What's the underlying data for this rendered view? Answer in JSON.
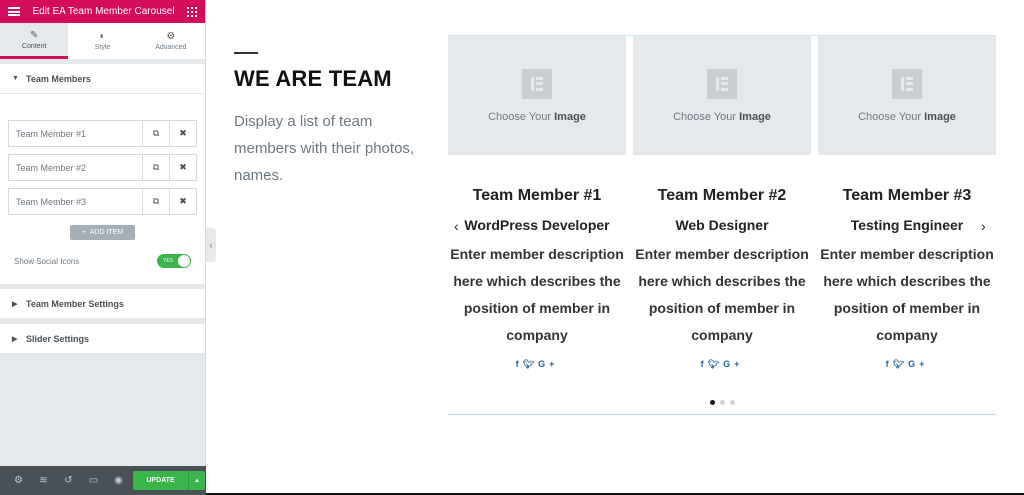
{
  "panel": {
    "header_title": "Edit EA Team Member Carousel",
    "tabs": [
      {
        "label": "Content",
        "icon": "pencil-icon"
      },
      {
        "label": "Style",
        "icon": "contrast-icon"
      },
      {
        "label": "Advanced",
        "icon": "gear-icon"
      }
    ],
    "section_team_members": "Team Members",
    "members": [
      {
        "label": "Team Member #1"
      },
      {
        "label": "Team Member #2"
      },
      {
        "label": "Team Member #3"
      }
    ],
    "add_item_label": "ADD ITEM",
    "show_social_label": "Show Social Icons",
    "show_social_toggle": "YES",
    "section_member_settings": "Team Member Settings",
    "section_slider_settings": "Slider Settings",
    "update_label": "UPDATE"
  },
  "preview": {
    "heading": "WE ARE TEAM",
    "description": "Display a list of team members with their photos, names.",
    "image_placeholder_pre": "Choose Your",
    "image_placeholder_bold": "Image",
    "cards": [
      {
        "name": "Team Member #1",
        "role": "WordPress Developer",
        "description": "Enter member description here which describes the position of member in company",
        "social": "f  ✓  G+"
      },
      {
        "name": "Team Member #2",
        "role": "Web Designer",
        "description": "Enter member description here which describes the position of member in company",
        "social": "f  ✓  G+"
      },
      {
        "name": "Team Member #3",
        "role": "Testing Engineer",
        "description": "Enter member description here which describes the position of member in company",
        "social": "f  ✓  G+"
      }
    ],
    "active_dot": 0,
    "dot_count": 3
  },
  "colors": {
    "brand": "#d30c5c",
    "update": "#39b54a",
    "social": "#1f5f9c"
  }
}
